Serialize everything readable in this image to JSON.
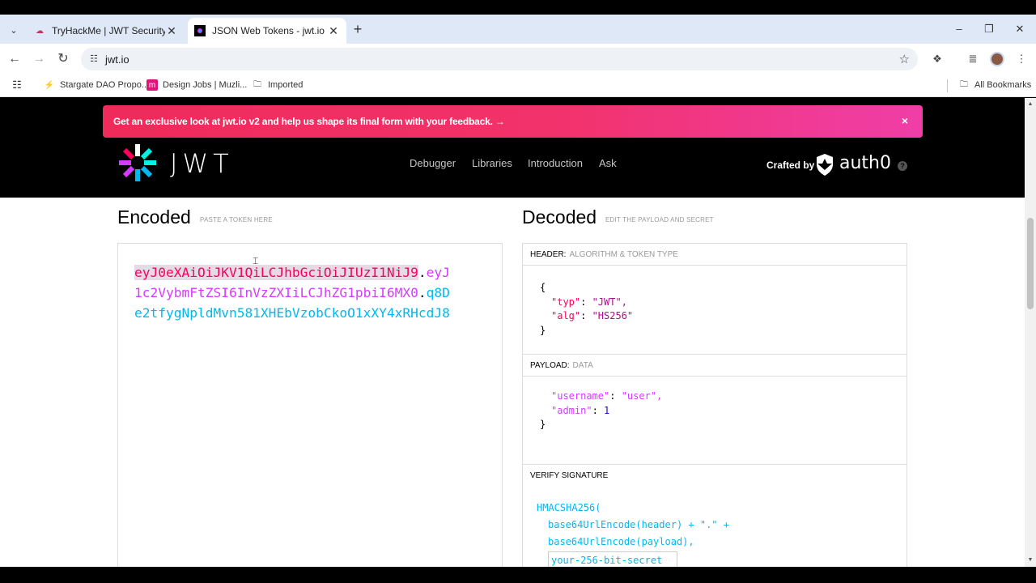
{
  "browser": {
    "tabs": [
      {
        "title": "TryHackMe | JWT Security",
        "active": false
      },
      {
        "title": "JSON Web Tokens - jwt.io",
        "active": true
      }
    ],
    "url": "jwt.io",
    "bookmarks": [
      {
        "label": "Stargate DAO Propo..."
      },
      {
        "label": "Design Jobs | Muzli..."
      },
      {
        "label": "Imported"
      }
    ],
    "all_bookmarks": "All Bookmarks"
  },
  "banner": {
    "text": "Get an exclusive look at jwt.io v2 and help us shape its final form with your feedback.  →",
    "close": "×"
  },
  "header": {
    "logo_word": "JWT",
    "nav": [
      "Debugger",
      "Libraries",
      "Introduction",
      "Ask"
    ],
    "crafted_by": "Crafted by",
    "brand": "auth0",
    "help": "?"
  },
  "encoded": {
    "title": "Encoded",
    "hint": "PASTE A TOKEN HERE",
    "header_part": "eyJ0eXAiOiJKV1QiLCJhbGciOiJIUzI1NiJ9",
    "payload_part": "eyJ1c2VybmFtZSI6InVzZXIiLCJhZG1pbiI6MX0",
    "signature_part": "q8De2tfygNpldMvn581XHEbVzobCkoO1xXY4xRHcdJ8",
    "dot": "."
  },
  "decoded": {
    "title": "Decoded",
    "hint": "EDIT THE PAYLOAD AND SECRET",
    "header_label": "HEADER:",
    "header_sub": "ALGORITHM & TOKEN TYPE",
    "payload_label": "PAYLOAD:",
    "payload_sub": "DATA",
    "verify_label": "VERIFY SIGNATURE",
    "header_json": {
      "open": "{",
      "typ_key": "\"typ\"",
      "typ_val": "\"JWT\",",
      "alg_key": "\"alg\"",
      "alg_val": "\"HS256\"",
      "close": "}"
    },
    "payload_json": {
      "username_key": "\"username\"",
      "username_val": "\"user\",",
      "admin_key": "\"admin\"",
      "admin_val": "1",
      "close": "}"
    },
    "signature": {
      "line1": "HMACSHA256(",
      "line2": "base64UrlEncode(header) + \".\" +",
      "line3": "base64UrlEncode(payload),",
      "secret": "your-256-bit-secret"
    }
  },
  "colors": {
    "header": "#fb015b",
    "payload": "#d63aff",
    "signature": "#00b9f1"
  }
}
